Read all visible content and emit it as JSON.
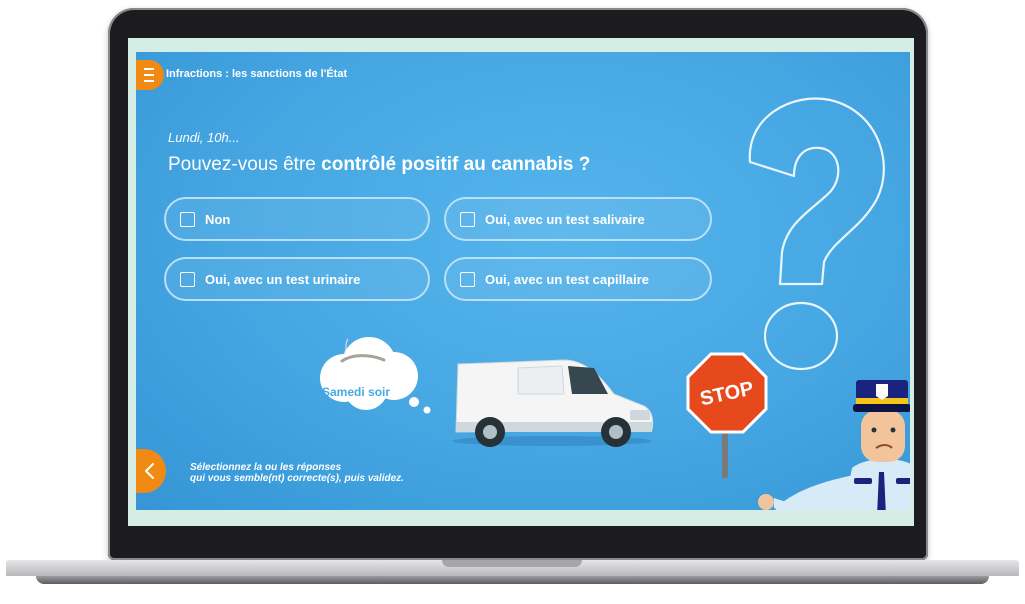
{
  "header": {
    "title": "Infractions : les sanctions de l'État"
  },
  "question": {
    "eyebrow": "Lundi, 10h...",
    "prefix": "Pouvez-vous être ",
    "bold": "contrôlé positif au cannabis ?"
  },
  "options": [
    {
      "label": "Non",
      "checked": false
    },
    {
      "label": "Oui, avec un test salivaire",
      "checked": false
    },
    {
      "label": "Oui, avec un test urinaire",
      "checked": false
    },
    {
      "label": "Oui, avec un test capillaire",
      "checked": false
    }
  ],
  "scene": {
    "cloud_text": "Samedi soir",
    "sign_text": "STOP"
  },
  "footer": {
    "hint_line1": "Sélectionnez la ou les réponses",
    "hint_line2": "qui vous semble(nt) correcte(s), puis validez."
  },
  "icons": {
    "menu": "hamburger-menu-icon",
    "back": "chevron-left-icon",
    "question_mark": "question-mark-icon",
    "checkbox": "checkbox-icon"
  },
  "colors": {
    "background": "#45a6e2",
    "accent": "#f18a12",
    "stop_sign": "#e64a1c",
    "option_border": "#b9e0f6"
  }
}
